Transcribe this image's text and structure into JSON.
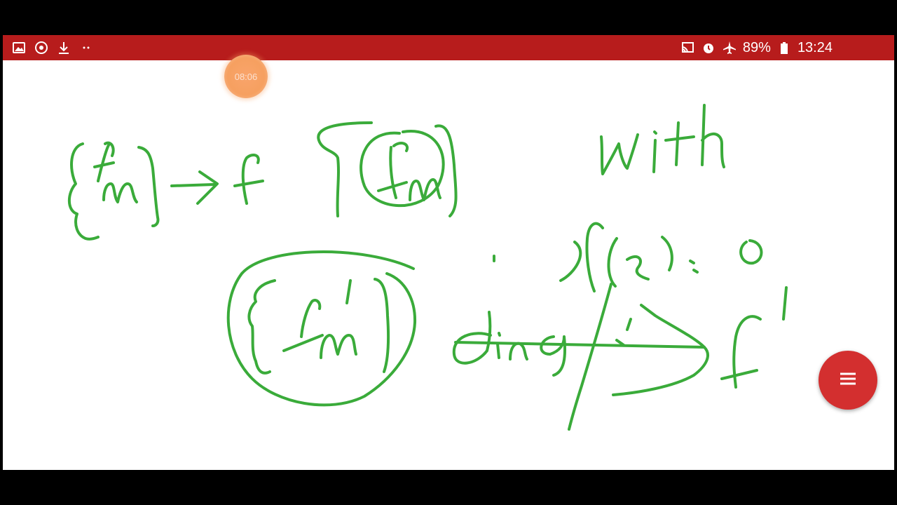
{
  "status_bar": {
    "battery": "89%",
    "time": "13:24",
    "left_icons": [
      "gallery-icon",
      "screen-recorder-icon",
      "download-icon",
      "more-notifications-icon"
    ],
    "right_icons": [
      "cast-icon",
      "alarm-icon",
      "airplane-mode-icon",
      "battery-icon"
    ],
    "background": "#b71c1c"
  },
  "recorder": {
    "elapsed": "08:06"
  },
  "whiteboard": {
    "ink_color": "#3aab3a",
    "background": "#ffffff"
  },
  "fab": {
    "icon": "menu-icon",
    "color": "#d32f2f"
  }
}
